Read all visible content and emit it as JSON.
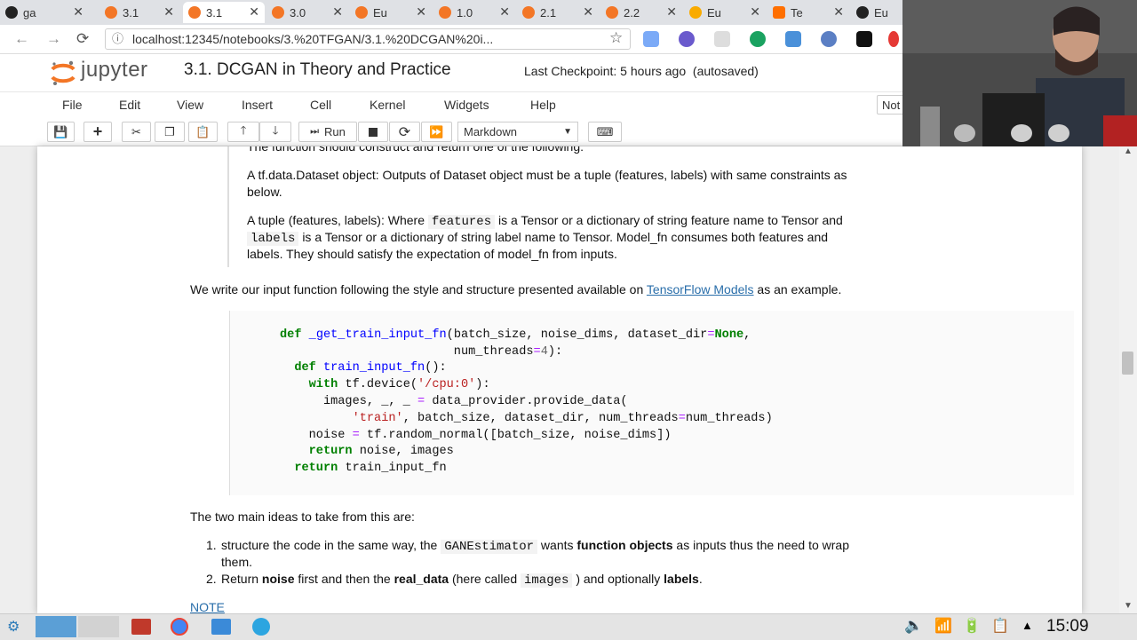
{
  "browser": {
    "tabs": [
      {
        "label": "ga",
        "icon": "github-icon"
      },
      {
        "label": "3.1",
        "icon": "jupyter-icon"
      },
      {
        "label": "3.1",
        "icon": "jupyter-icon",
        "active": true
      },
      {
        "label": "3.0",
        "icon": "jupyter-icon"
      },
      {
        "label": "Eu",
        "icon": "jupyter-icon"
      },
      {
        "label": "1.0",
        "icon": "jupyter-icon"
      },
      {
        "label": "2.1",
        "icon": "jupyter-icon"
      },
      {
        "label": "2.2",
        "icon": "jupyter-icon"
      },
      {
        "label": "Eu",
        "icon": "colab-icon"
      },
      {
        "label": "Te",
        "icon": "tensorflow-icon"
      },
      {
        "label": "Eu",
        "icon": "github-icon"
      }
    ],
    "url": "localhost:12345/notebooks/3.%20TFGAN/3.1.%20DCGAN%20i..."
  },
  "jupyter": {
    "logo_text": "jupyter",
    "title": "3.1. DCGAN in Theory and Practice",
    "checkpoint": "Last Checkpoint: 5 hours ago",
    "autosaved": "(autosaved)",
    "menus": [
      "File",
      "Edit",
      "View",
      "Insert",
      "Cell",
      "Kernel",
      "Widgets",
      "Help"
    ],
    "kernel_indicator": "Not",
    "toolbar": {
      "run_label": "Run",
      "cell_type": "Markdown"
    }
  },
  "content": {
    "partial_top": "The function should construct and return one of the following:",
    "p1_line1": "A tf.data.Dataset object: Outputs of Dataset object must be a tuple (features, labels) with same constraints as",
    "p1_line2": "below.",
    "p2_a": "A tuple (features, labels): Where",
    "p2_code1": "features",
    "p2_b": "is a Tensor or a dictionary of string feature name to Tensor and",
    "p2_code2": "labels",
    "p2_c": "is a Tensor or a dictionary of string label name to Tensor. Model_fn consumes both features and",
    "p2_d": "labels. They should satisfy the expectation of model_fn from inputs.",
    "p3_a": "We write our input function following the style and structure presented available on",
    "p3_link": "TensorFlow Models",
    "p3_b": "as an example.",
    "code_lines": [
      "def _get_train_input_fn(batch_size, noise_dims, dataset_dir=None,",
      "                        num_threads=4):",
      "  def train_input_fn():",
      "    with tf.device('/cpu:0'):",
      "      images, _, _ = data_provider.provide_data(",
      "          'train', batch_size, dataset_dir, num_threads=num_threads)",
      "    noise = tf.random_normal([batch_size, noise_dims])",
      "    return noise, images",
      "  return train_input_fn"
    ],
    "ideas_intro": "The two main ideas to take from this are:",
    "item1_num": "1.",
    "item1_a": "structure the code in the same way, the",
    "item1_code": "GANEstimator",
    "item1_b": "wants",
    "item1_bold": "function objects",
    "item1_c": "as inputs thus the need to wrap",
    "item1_d": "them.",
    "item2_num": "2.",
    "item2_a": "Return",
    "item2_bold1": "noise",
    "item2_b": "first and then the",
    "item2_bold2": "real_data",
    "item2_c": "(here called",
    "item2_code": "images",
    "item2_d": ") and optionally",
    "item2_bold3": "labels",
    "item2_e": ".",
    "note_link": "NOTE"
  },
  "taskbar": {
    "clock": "15:09"
  },
  "colors": {
    "link": "#296eaa",
    "keyword": "#008000",
    "string": "#ba2121",
    "funcname": "#0000ff"
  }
}
